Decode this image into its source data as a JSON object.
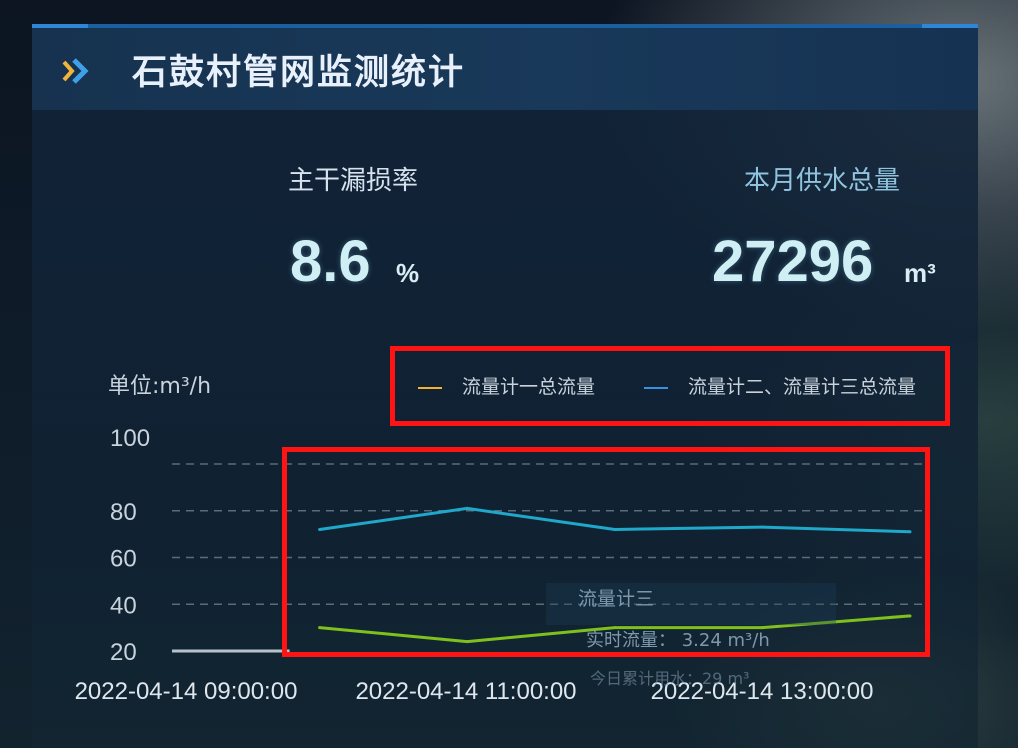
{
  "header": {
    "title": "石鼓村管网监测统计"
  },
  "stats": {
    "leak_rate": {
      "label": "主干漏损率",
      "value": "8.6",
      "unit": "%"
    },
    "monthly_supply": {
      "label": "本月供水总量",
      "value": "27296",
      "unit": "m³"
    }
  },
  "overlay": {
    "title": "流量计三",
    "realtime": "实时流量：  3.24 m³/h",
    "today": "今日累计用水：29 m³"
  },
  "colors": {
    "series1": "#f2b32a",
    "series2": "#3a8fe0",
    "cyan_line": "#1fa8c9",
    "green_line": "#7fc01c",
    "highlight": "#ff1414"
  },
  "chart_data": {
    "type": "line",
    "unit_label": "单位:m³/h",
    "legend": [
      "流量计一总流量",
      "流量计二、流量计三总流量"
    ],
    "y_ticks": [
      "100",
      "80",
      "60",
      "40",
      "20"
    ],
    "ylim": [
      20,
      100
    ],
    "x_ticks": [
      "2022-04-14 09:00:00",
      "2022-04-14 11:00:00",
      "2022-04-14 13:00:00"
    ],
    "grid": true,
    "legend_position": "top-right",
    "series": [
      {
        "name": "流量计一总流量",
        "color": "#7fc01c",
        "x": [
          "10:00",
          "11:00",
          "12:00",
          "13:00",
          "14:00"
        ],
        "values": [
          30,
          24,
          30,
          30,
          35
        ]
      },
      {
        "name": "流量计二、流量计三总流量",
        "color": "#1fa8c9",
        "x": [
          "10:00",
          "11:00",
          "12:00",
          "13:00",
          "14:00"
        ],
        "values": [
          72,
          81,
          72,
          73,
          71
        ]
      }
    ],
    "baseline_segment": {
      "x": [
        "09:00",
        "10:00"
      ],
      "values": [
        20,
        20
      ]
    }
  }
}
